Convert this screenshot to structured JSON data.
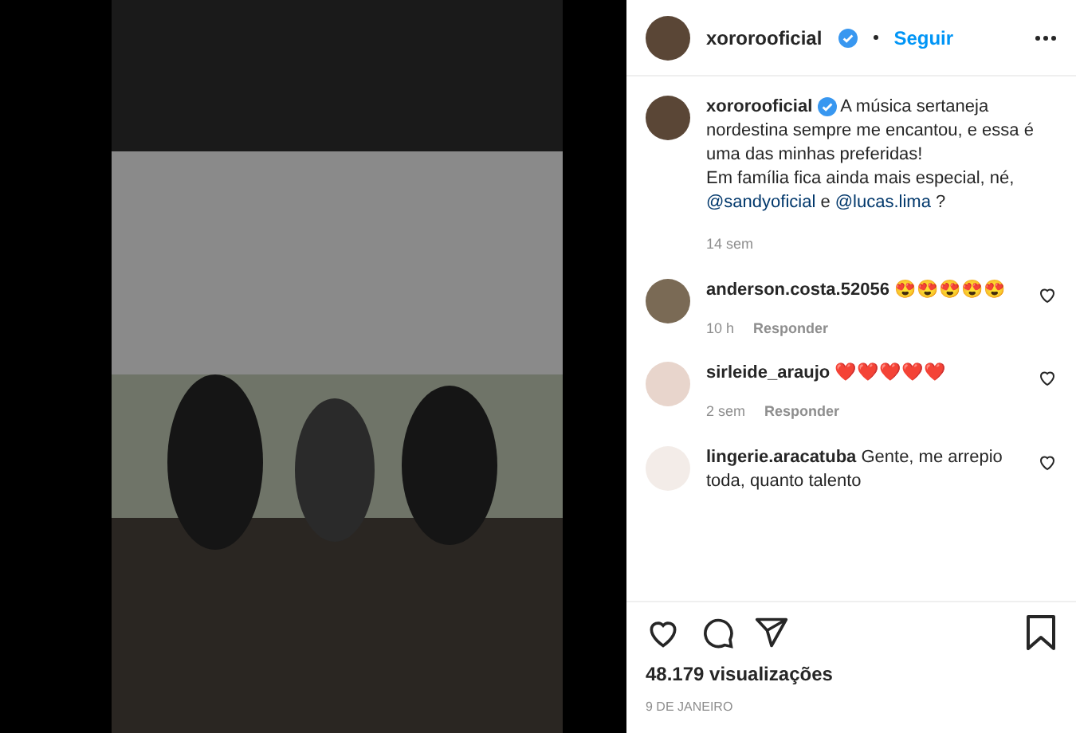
{
  "post": {
    "author": "xororooficial",
    "verified": true,
    "follow": "Seguir",
    "caption": {
      "author": "xororooficial",
      "verified": true,
      "segments": [
        {
          "kind": "text",
          "text": "A música sertaneja nordestina sempre me encantou, e essa é uma das minhas preferidas!\nEm família fica ainda mais especial, né, "
        },
        {
          "kind": "mention",
          "text": "@sandyoficial"
        },
        {
          "kind": "text",
          "text": " e "
        },
        {
          "kind": "mention",
          "text": "@lucas.lima"
        },
        {
          "kind": "text",
          "text": " ?"
        }
      ],
      "time": "14 sem"
    },
    "comments": [
      {
        "user": "anderson.costa.52056",
        "text": "😍😍😍😍😍",
        "time": "10 h",
        "reply": "Responder"
      },
      {
        "user": "sirleide_araujo",
        "text": "❤️❤️❤️❤️❤️",
        "time": "2 sem",
        "reply": "Responder"
      },
      {
        "user": "lingerie.aracatuba",
        "text": "Gente, me arrepio toda, quanto talento"
      }
    ],
    "views": "48.179 visualizações",
    "date": "9 DE JANEIRO"
  }
}
